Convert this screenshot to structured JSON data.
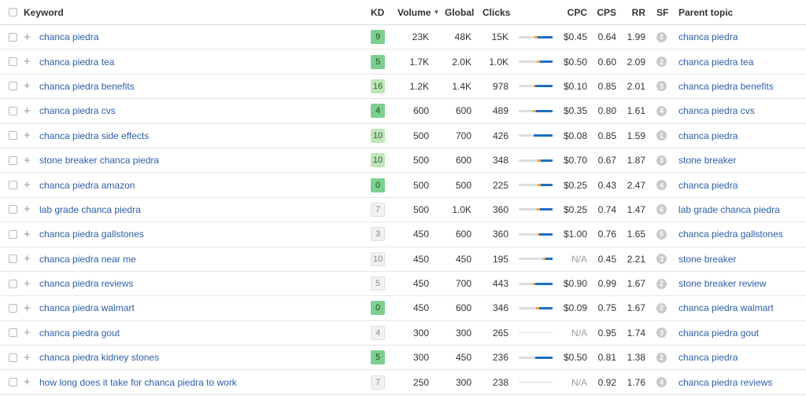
{
  "header": {
    "keyword": "Keyword",
    "kd": "KD",
    "volume": "Volume",
    "global": "Global",
    "clicks": "Clicks",
    "cpc": "CPC",
    "cps": "CPS",
    "rr": "RR",
    "sf": "SF",
    "parent_topic": "Parent topic"
  },
  "colors": {
    "link": "#2c5fa8",
    "kd_green": "#7ccf8e",
    "kd_light": "#bfe6b9",
    "kd_grey": "#f1f1f1",
    "clicks_orange": "#f5a341",
    "clicks_blue": "#1f6fc1"
  },
  "rows": [
    {
      "keyword": "chanca piedra",
      "kd": "9",
      "kd_style": "green",
      "volume": "23K",
      "global": "48K",
      "clicks": "15K",
      "clicks_share": {
        "orange": 0.1,
        "blue": 0.45
      },
      "cpc": "$0.45",
      "cps": "0.64",
      "rr": "1.99",
      "sf": "2",
      "parent": "chanca piedra"
    },
    {
      "keyword": "chanca piedra tea",
      "kd": "5",
      "kd_style": "green",
      "volume": "1.7K",
      "global": "2.0K",
      "clicks": "1.0K",
      "clicks_share": {
        "orange": 0.1,
        "blue": 0.38
      },
      "cpc": "$0.50",
      "cps": "0.60",
      "rr": "2.09",
      "sf": "2",
      "parent": "chanca piedra tea"
    },
    {
      "keyword": "chanca piedra benefits",
      "kd": "16",
      "kd_style": "light",
      "volume": "1.2K",
      "global": "1.4K",
      "clicks": "978",
      "clicks_share": {
        "orange": 0.05,
        "blue": 0.52
      },
      "cpc": "$0.10",
      "cps": "0.85",
      "rr": "2.01",
      "sf": "3",
      "parent": "chanca piedra benefits"
    },
    {
      "keyword": "chanca piedra cvs",
      "kd": "4",
      "kd_style": "green",
      "volume": "600",
      "global": "600",
      "clicks": "489",
      "clicks_share": {
        "orange": 0.1,
        "blue": 0.48
      },
      "cpc": "$0.35",
      "cps": "0.80",
      "rr": "1.61",
      "sf": "4",
      "parent": "chanca piedra cvs"
    },
    {
      "keyword": "chanca piedra side effects",
      "kd": "10",
      "kd_style": "light",
      "volume": "500",
      "global": "700",
      "clicks": "426",
      "clicks_share": {
        "orange": 0.0,
        "blue": 0.55
      },
      "cpc": "$0.08",
      "cps": "0.85",
      "rr": "1.59",
      "sf": "1",
      "parent": "chanca piedra"
    },
    {
      "keyword": "stone breaker chanca piedra",
      "kd": "10",
      "kd_style": "light",
      "volume": "500",
      "global": "600",
      "clicks": "348",
      "clicks_share": {
        "orange": 0.1,
        "blue": 0.35
      },
      "cpc": "$0.70",
      "cps": "0.67",
      "rr": "1.87",
      "sf": "3",
      "parent": "stone breaker"
    },
    {
      "keyword": "chanca piedra amazon",
      "kd": "0",
      "kd_style": "green",
      "volume": "500",
      "global": "500",
      "clicks": "225",
      "clicks_share": {
        "orange": 0.1,
        "blue": 0.35
      },
      "cpc": "$0.25",
      "cps": "0.43",
      "rr": "2.47",
      "sf": "4",
      "parent": "chanca piedra"
    },
    {
      "keyword": "lab grade chanca piedra",
      "kd": "7",
      "kd_style": "grey",
      "volume": "500",
      "global": "1.0K",
      "clicks": "360",
      "clicks_share": {
        "orange": 0.1,
        "blue": 0.38
      },
      "cpc": "$0.25",
      "cps": "0.74",
      "rr": "1.47",
      "sf": "6",
      "parent": "lab grade chanca piedra"
    },
    {
      "keyword": "chanca piedra gallstones",
      "kd": "3",
      "kd_style": "grey",
      "volume": "450",
      "global": "600",
      "clicks": "360",
      "clicks_share": {
        "orange": 0.05,
        "blue": 0.4
      },
      "cpc": "$1.00",
      "cps": "0.76",
      "rr": "1.65",
      "sf": "5",
      "parent": "chanca piedra gallstones"
    },
    {
      "keyword": "chanca piedra near me",
      "kd": "10",
      "kd_style": "grey",
      "volume": "450",
      "global": "450",
      "clicks": "195",
      "clicks_share": {
        "orange": 0.08,
        "blue": 0.2
      },
      "cpc": "N/A",
      "cps": "0.45",
      "rr": "2.21",
      "sf": "3",
      "parent": "stone breaker"
    },
    {
      "keyword": "chanca piedra reviews",
      "kd": "5",
      "kd_style": "grey",
      "volume": "450",
      "global": "700",
      "clicks": "443",
      "clicks_share": {
        "orange": 0.08,
        "blue": 0.5
      },
      "cpc": "$0.90",
      "cps": "0.99",
      "rr": "1.67",
      "sf": "2",
      "parent": "stone breaker review"
    },
    {
      "keyword": "chanca piedra walmart",
      "kd": "0",
      "kd_style": "green",
      "volume": "450",
      "global": "600",
      "clicks": "346",
      "clicks_share": {
        "orange": 0.1,
        "blue": 0.4
      },
      "cpc": "$0.09",
      "cps": "0.75",
      "rr": "1.67",
      "sf": "2",
      "parent": "chanca piedra walmart"
    },
    {
      "keyword": "chanca piedra gout",
      "kd": "4",
      "kd_style": "grey",
      "volume": "300",
      "global": "300",
      "clicks": "265",
      "clicks_share": {
        "orange": 0.0,
        "blue": 0.0
      },
      "cpc": "N/A",
      "cps": "0.95",
      "rr": "1.74",
      "sf": "3",
      "parent": "chanca piedra gout"
    },
    {
      "keyword": "chanca piedra kidney stones",
      "kd": "5",
      "kd_style": "green",
      "volume": "300",
      "global": "450",
      "clicks": "236",
      "clicks_share": {
        "orange": 0.0,
        "blue": 0.5
      },
      "cpc": "$0.50",
      "cps": "0.81",
      "rr": "1.38",
      "sf": "2",
      "parent": "chanca piedra"
    },
    {
      "keyword": "how long does it take for chanca piedra to work",
      "kd": "7",
      "kd_style": "grey",
      "volume": "250",
      "global": "300",
      "clicks": "238",
      "clicks_share": {
        "orange": 0.0,
        "blue": 0.0
      },
      "cpc": "N/A",
      "cps": "0.92",
      "rr": "1.76",
      "sf": "4",
      "parent": "chanca piedra reviews"
    }
  ]
}
